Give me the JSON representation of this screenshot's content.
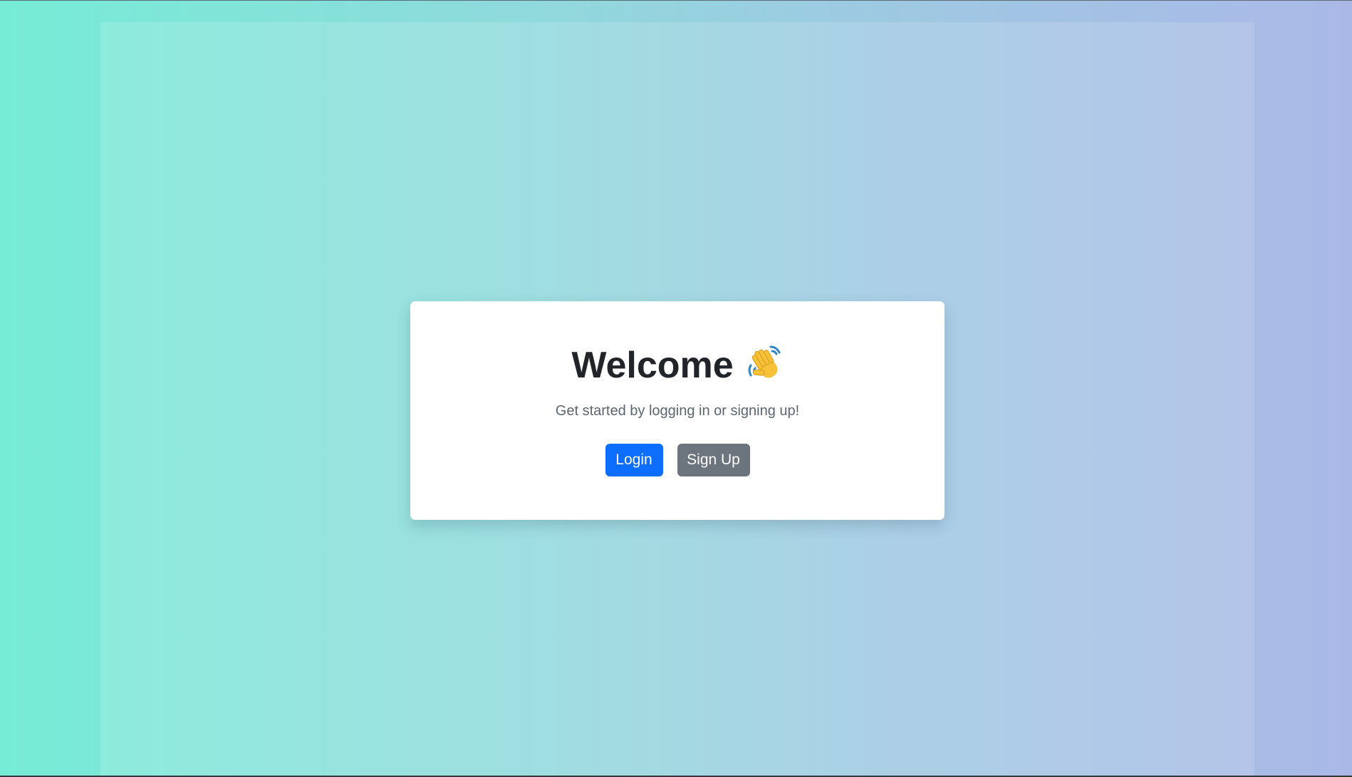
{
  "welcome": {
    "title": "Welcome",
    "title_emoji": "waving-hand-icon",
    "subtitle": "Get started by logging in or signing up!"
  },
  "actions": {
    "login_label": "Login",
    "signup_label": "Sign Up"
  },
  "colors": {
    "login_button": "#0d6efd",
    "signup_button": "#6c757d",
    "background_start": "#76ecd6",
    "background_end": "#aab8e7"
  }
}
